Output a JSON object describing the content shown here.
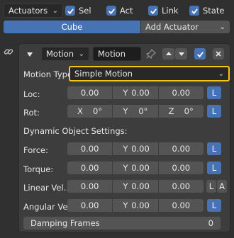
{
  "topbar": {
    "dropdown_label": "Actuators",
    "checkboxes": [
      {
        "label": "Sel",
        "checked": true
      },
      {
        "label": "Act",
        "checked": true
      },
      {
        "label": "Link",
        "checked": true
      },
      {
        "label": "State",
        "checked": true
      }
    ]
  },
  "tabs": {
    "object": "Cube",
    "add": "Add Actuator"
  },
  "actuator": {
    "type": "Motion",
    "name": "Motion",
    "enabled": true,
    "motion_type_label": "Motion Type:",
    "motion_type_value": "Simple Motion",
    "loc": {
      "label": "Loc:",
      "x": "0.00",
      "y_axis": "Y",
      "y": "0.00",
      "z": "0.00",
      "local": "L"
    },
    "rot": {
      "label": "Rot:",
      "x_axis": "X",
      "x": "0°",
      "y_axis": "Y",
      "y": "0°",
      "z_axis": "Z",
      "z": "0°",
      "local": "L"
    },
    "dynamic_heading": "Dynamic Object Settings:",
    "force": {
      "label": "Force:",
      "x": "0.00",
      "y_axis": "Y",
      "y": "0.00",
      "z": "0.00",
      "local": "L"
    },
    "torque": {
      "label": "Torque:",
      "x": "0.00",
      "y_axis": "Y",
      "y": "0.00",
      "z": "0.00",
      "local": "L"
    },
    "linear_vel": {
      "label": "Linear Vel...",
      "x": "0.00",
      "y_axis": "Y",
      "y": "0.00",
      "z": "0.00",
      "local": "L",
      "add": "A"
    },
    "angular_vel": {
      "label": "Angular Ve...",
      "x": "0.00",
      "y_axis": "Y",
      "y": "0.00",
      "z": "0.00",
      "local": "L"
    },
    "damping": {
      "label": "Damping Frames",
      "value": "0"
    }
  },
  "colors": {
    "accent": "#4772b3",
    "highlight": "#f5c518"
  }
}
